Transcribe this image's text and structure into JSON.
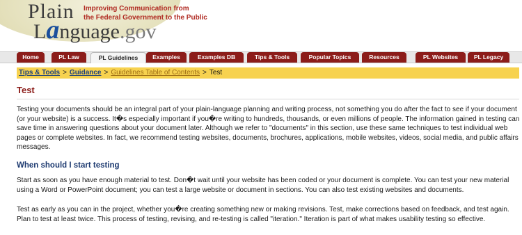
{
  "site": {
    "logo_line1": "Plain",
    "logo_line2_a": "a",
    "logo_line2_rest": "nguage",
    "logo_line2_prefix": "L",
    "logo_domain": ".gov",
    "tagline_line1": "Improving Communication from",
    "tagline_line2": "the Federal Government to the Public"
  },
  "nav": {
    "items": [
      {
        "label": "Home"
      },
      {
        "label": "PL Law"
      },
      {
        "label": "PL Guidelines"
      },
      {
        "label": "Examples"
      },
      {
        "label": "Examples DB"
      },
      {
        "label": "Tips & Tools"
      },
      {
        "label": "Popular Topics"
      },
      {
        "label": "Resources"
      },
      {
        "label": "PL Websites"
      },
      {
        "label": "PL Legacy"
      }
    ],
    "active": "PL Guidelines"
  },
  "breadcrumb": {
    "items": [
      {
        "label": "Tips & Tools"
      },
      {
        "label": "Guidance"
      },
      {
        "label": "Guidelines Table of Contents"
      }
    ],
    "separator": ">",
    "current": "Test"
  },
  "page": {
    "title": "Test",
    "intro": "Testing your documents should be an integral part of your plain-language planning and writing process, not something you do after the fact to see if your document (or your website) is a success. It�s especially important if you�re writing to hundreds, thousands, or even millions of people. The information gained in testing can save time in answering questions about your document later. Although we refer to \"documents\" in this section, use these same techniques to test individual web pages or complete websites. In fact, we recommend testing websites, documents, brochures, applications, mobile websites, videos, social media, and public affairs messages.",
    "section_heading": "When should I start testing",
    "para1": "Start as soon as you have enough material to test. Don�t wait until your website has been coded or your document is complete. You can test your new material using a Word or PowerPoint document; you can test a large website or document in sections. You can also test existing websites and documents.",
    "para2": "Test as early as you can in the project, whether you�re creating something new or making revisions. Test, make corrections based on feedback, and test again. Plan to test at least twice. This process of testing, revising, and re-testing is called \"iteration.\" Iteration is part of what makes usability testing so effective."
  },
  "colors": {
    "nav_tab": "#8c1d1a",
    "breadcrumb_bar": "#f7d24f",
    "title": "#8c1d1a",
    "heading": "#1d3a70",
    "tagline": "#b02a22"
  }
}
